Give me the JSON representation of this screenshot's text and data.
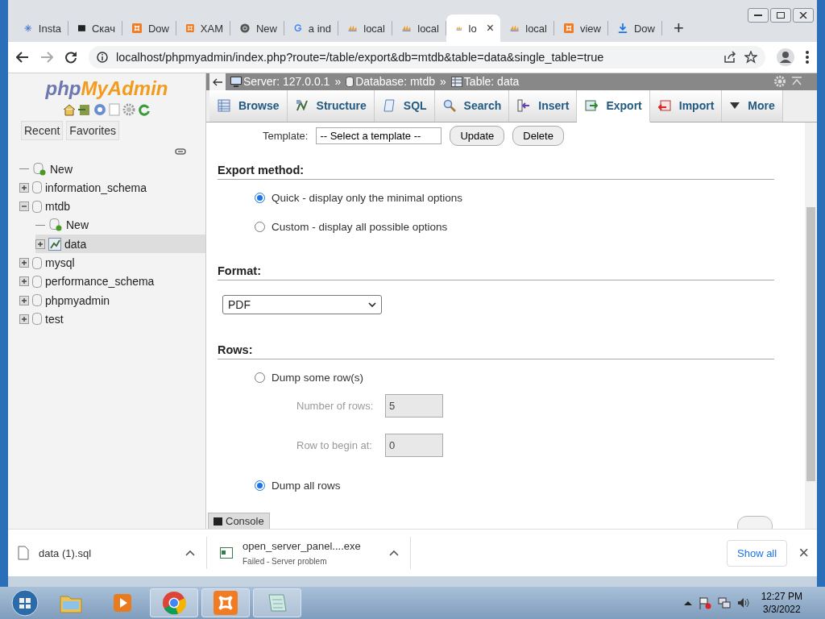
{
  "browser": {
    "tabs": [
      {
        "title": "Insta",
        "kind": "star",
        "selected": false
      },
      {
        "title": "Скач",
        "kind": "terminal",
        "selected": false
      },
      {
        "title": "Dow",
        "kind": "xampp",
        "selected": false
      },
      {
        "title": "XAM",
        "kind": "xampp",
        "selected": false
      },
      {
        "title": "New",
        "kind": "chrome",
        "selected": false
      },
      {
        "title": "a ind",
        "kind": "google",
        "selected": false
      },
      {
        "title": "local",
        "kind": "pma",
        "selected": false
      },
      {
        "title": "local",
        "kind": "pma",
        "selected": false
      },
      {
        "title": "lo",
        "kind": "pma",
        "selected": true,
        "close": "×"
      },
      {
        "title": "local",
        "kind": "pma",
        "selected": false
      },
      {
        "title": "view",
        "kind": "xampp",
        "selected": false
      },
      {
        "title": "Dow",
        "kind": "download",
        "selected": false
      }
    ],
    "new_tab": "+",
    "address": "localhost/phpmyadmin/index.php?route=/table/export&db=mtdb&table=data&single_table=true"
  },
  "sidebar": {
    "logo_a": "php",
    "logo_b": "MyAdmin",
    "buttons": [
      {
        "label": "Recent"
      },
      {
        "label": "Favorites"
      }
    ],
    "tree": [
      {
        "label": "New",
        "kind": "new",
        "selected": false
      },
      {
        "label": "information_schema",
        "kind": "db",
        "expanded": false,
        "selected": false
      },
      {
        "label": "mtdb",
        "kind": "db",
        "expanded": true,
        "selected": false,
        "children": [
          {
            "label": "New",
            "kind": "new",
            "selected": false
          },
          {
            "label": "data",
            "kind": "table",
            "expanded": false,
            "selected": true
          }
        ]
      },
      {
        "label": "mysql",
        "kind": "db",
        "expanded": false,
        "selected": false
      },
      {
        "label": "performance_schema",
        "kind": "db",
        "expanded": false,
        "selected": false
      },
      {
        "label": "phpmyadmin",
        "kind": "db",
        "expanded": false,
        "selected": false
      },
      {
        "label": "test",
        "kind": "db",
        "expanded": false,
        "selected": false
      }
    ]
  },
  "breadcrumb": [
    {
      "label": "Server: 127.0.0.1",
      "kind": "server"
    },
    {
      "label": "Database: mtdb",
      "kind": "db"
    },
    {
      "label": "Table: data",
      "kind": "table"
    }
  ],
  "breadcrumb_separator": "»",
  "tabs": [
    {
      "label": "Browse",
      "kind": "browse",
      "selected": false
    },
    {
      "label": "Structure",
      "kind": "structure",
      "selected": false
    },
    {
      "label": "SQL",
      "kind": "sql",
      "selected": false
    },
    {
      "label": "Search",
      "kind": "search",
      "selected": false
    },
    {
      "label": "Insert",
      "kind": "insert",
      "selected": false
    },
    {
      "label": "Export",
      "kind": "export",
      "selected": true
    },
    {
      "label": "Import",
      "kind": "import",
      "selected": false
    },
    {
      "label": "More",
      "kind": "caret",
      "selected": false
    }
  ],
  "template": {
    "label": "Template:",
    "select": "-- Select a template --",
    "buttons": [
      "Update",
      "Delete"
    ]
  },
  "export_method": {
    "heading": "Export method:",
    "options": [
      {
        "label": "Quick - display only the minimal options",
        "selected": true
      },
      {
        "label": "Custom - display all possible options",
        "selected": false
      }
    ]
  },
  "format": {
    "heading": "Format:",
    "value": "PDF"
  },
  "rows": {
    "heading": "Rows:",
    "options": [
      {
        "label": "Dump some row(s)",
        "selected": false,
        "fields": [
          {
            "label": "Number of rows:",
            "value": "5",
            "disabled": true
          },
          {
            "label": "Row to begin at:",
            "value": "0",
            "disabled": true
          }
        ]
      },
      {
        "label": "Dump all rows",
        "selected": true
      }
    ]
  },
  "console": "Console",
  "downloads": {
    "items": [
      {
        "name": "data (1).sql",
        "kind": "file"
      },
      {
        "name": "open_server_panel....exe",
        "status": "Failed - Server problem",
        "kind": "exe"
      }
    ],
    "show_all": "Show all",
    "close": "×"
  },
  "taskbar": {
    "apps": [
      {
        "kind": "explorer",
        "active": false
      },
      {
        "kind": "media",
        "active": false
      },
      {
        "kind": "chrome",
        "active": true
      },
      {
        "kind": "xampp",
        "active": true
      },
      {
        "kind": "notepad",
        "active": true
      }
    ],
    "time": "12:27 PM",
    "date": "3/3/2022"
  }
}
